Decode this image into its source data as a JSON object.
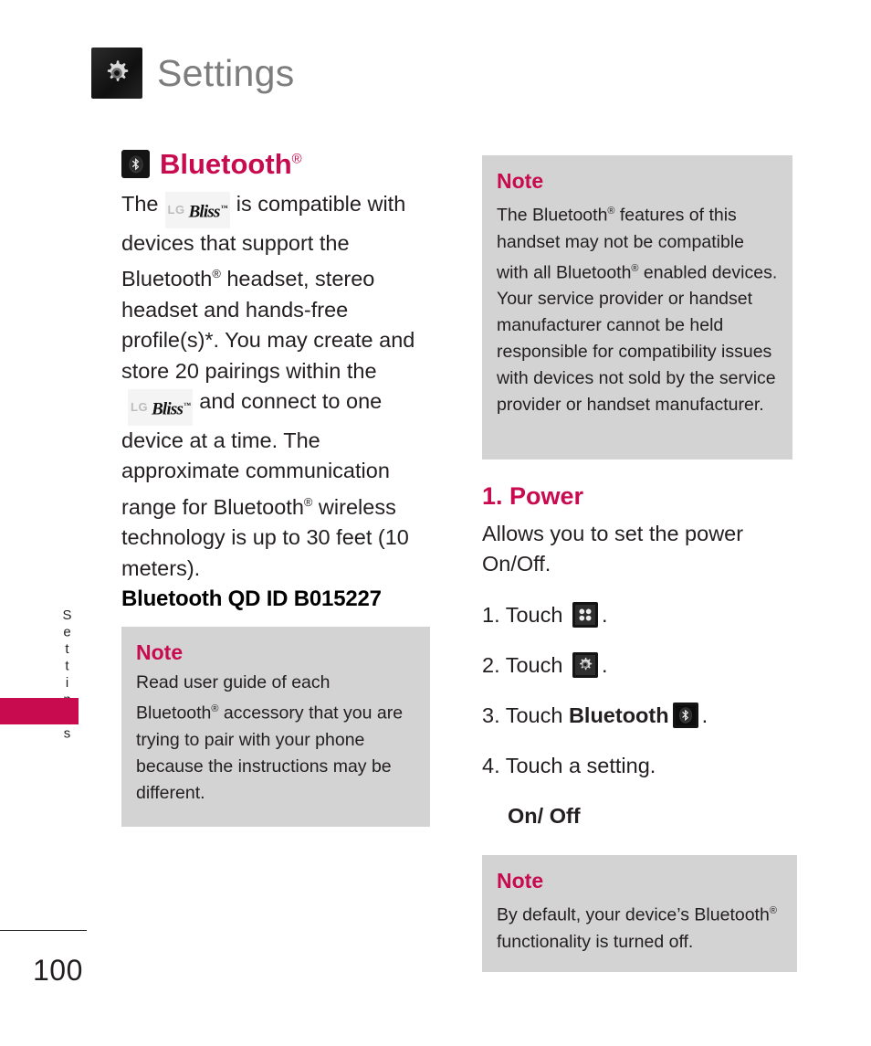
{
  "header": {
    "title": "Settings",
    "icon": "gear-icon"
  },
  "side_tab": {
    "label": "Settings"
  },
  "left_column": {
    "heading": {
      "icon": "bluetooth-icon",
      "text": "Bluetooth",
      "superscript": "®"
    },
    "paragraph": {
      "part1": "The",
      "device_logo_lg": "LG",
      "device_logo_name": "Bliss",
      "part2": "is compatible with devices that support the Bluetooth",
      "sup1": "®",
      "part3": " headset, stereo headset and hands-free profile(s)*. You may create and store 20 pairings within the",
      "part4": "and connect to one device at a time. The approximate communication range for Bluetooth",
      "sup2": "®",
      "part5": " wireless technology is up to 30 feet (10 meters)."
    },
    "qd_id": "Bluetooth QD ID B015227",
    "note": {
      "title": "Note",
      "body_part1": "Read user guide of each Bluetooth",
      "sup": "®",
      "body_part2": " accessory that you are trying to pair with your phone because the instructions may be different."
    }
  },
  "right_column": {
    "note_top": {
      "title": "Note",
      "body_part1": "The Bluetooth",
      "sup1": "®",
      "body_part2": " features of this handset may not be compatible with all Bluetooth",
      "sup2": "®",
      "body_part3": " enabled devices. Your service provider or handset manufacturer cannot be held responsible for compatibility issues with devices not sold by the service provider or handset manufacturer."
    },
    "section": {
      "heading": "1. Power",
      "description": "Allows you to set the power On/Off."
    },
    "steps": [
      {
        "number": "1. Touch ",
        "icon": "grid-menu-icon",
        "suffix": "."
      },
      {
        "number": "2. Touch ",
        "icon": "gear-icon",
        "suffix": "."
      },
      {
        "number": "3. Touch ",
        "bold": "Bluetooth",
        "icon": "bluetooth-icon",
        "suffix": "."
      },
      {
        "number": "4. Touch a setting.",
        "icon": null,
        "suffix": ""
      }
    ],
    "step_option": "On/ Off",
    "note_bottom": {
      "title": "Note",
      "body_part1": "By default, your device’s Bluetooth",
      "sup": "®",
      "body_part2": " functionality is turned off."
    }
  },
  "footer": {
    "page_number": "100"
  },
  "colors": {
    "accent": "#c80a4e",
    "note_bg": "#d3d3d3",
    "header_title": "#7d7d7d",
    "body": "#231f20"
  }
}
